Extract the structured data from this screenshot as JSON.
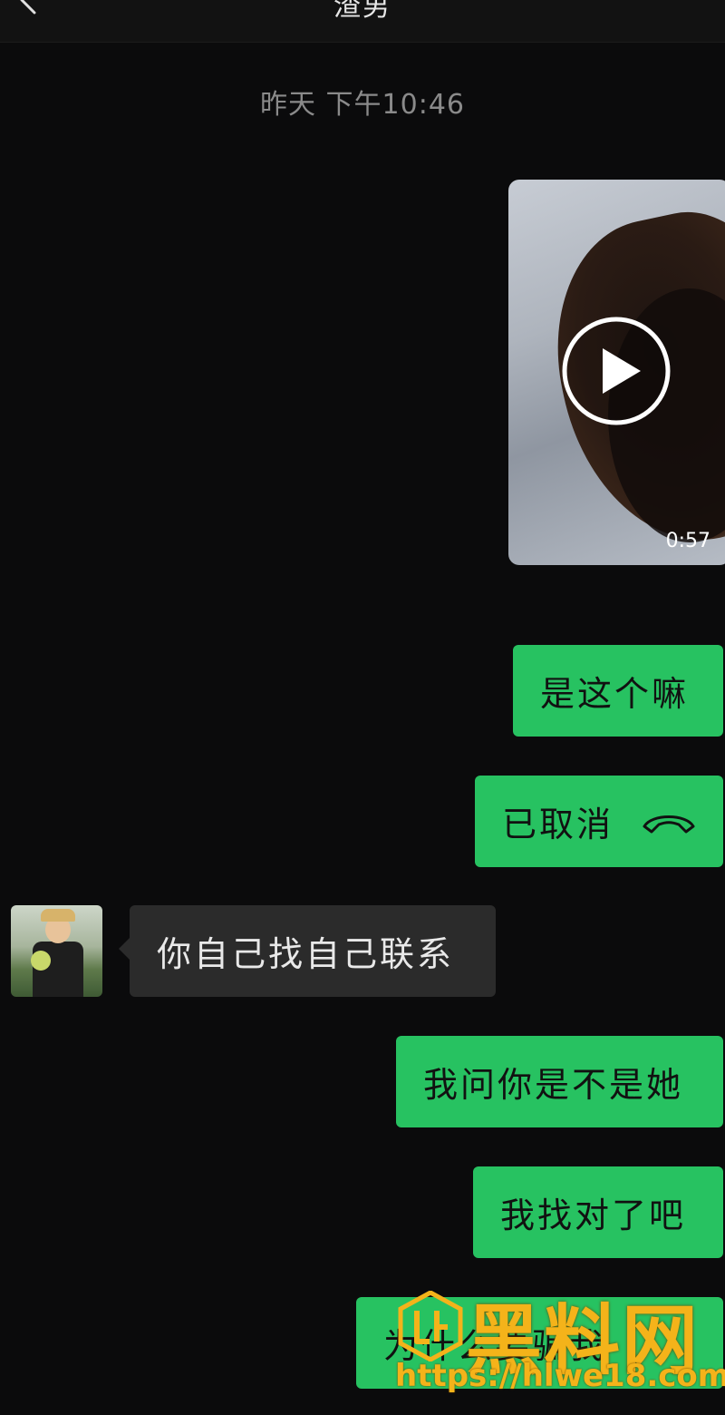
{
  "header": {
    "title": "渣男",
    "back_icon": "chevron-left-icon"
  },
  "timestamp": "昨天 下午10:46",
  "video_message": {
    "duration": "0:57",
    "icon": "play-icon"
  },
  "messages": [
    {
      "side": "out",
      "text": "是这个嘛"
    },
    {
      "side": "out",
      "text": "已取消",
      "icon": "phone-hangup-icon"
    },
    {
      "side": "in",
      "text": "你自己找自己联系"
    },
    {
      "side": "out",
      "text": "我问你是不是她"
    },
    {
      "side": "out",
      "text": "我找对了吧"
    },
    {
      "side": "out",
      "text": "为什么要骗我"
    }
  ],
  "watermark": {
    "text": "黑料网",
    "url": "https://hlwe18.com"
  },
  "colors": {
    "background": "#0b0b0c",
    "outgoing_bubble": "#27c261",
    "incoming_bubble": "#2b2b2b",
    "watermark": "#f4b31a"
  }
}
